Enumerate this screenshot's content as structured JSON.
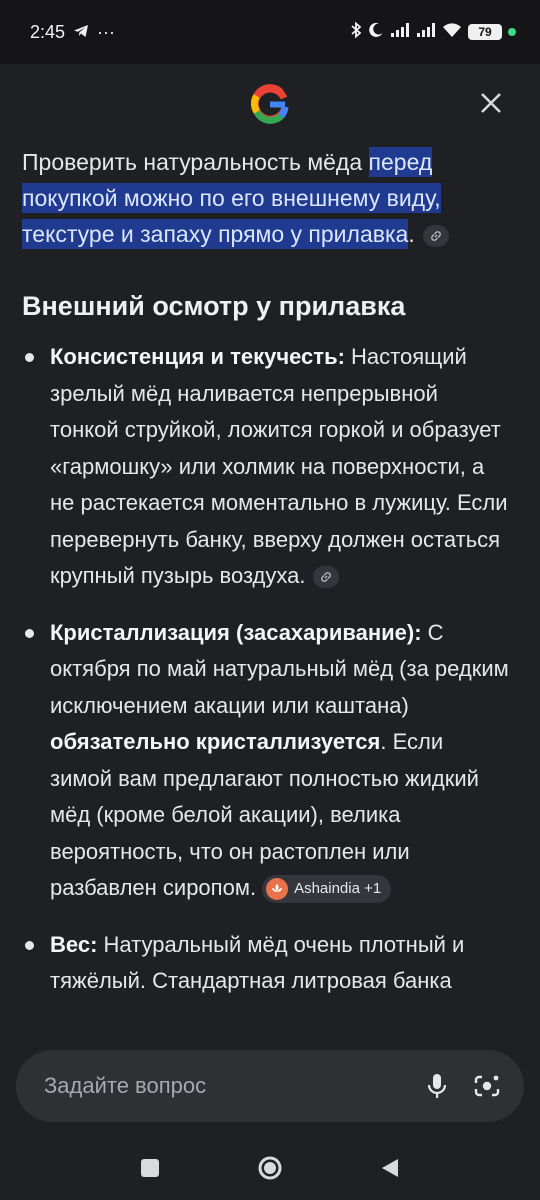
{
  "status_bar": {
    "time": "2:45",
    "dots": "···",
    "battery": "79"
  },
  "answer": {
    "intro_plain": "Проверить натуральность мёда ",
    "intro_highlight": "перед покупкой можно по его внешнему виду, текстуре и запаху прямо у прилавка",
    "intro_end": ".",
    "section_title": "Внешний осмотр у прилавка",
    "items": [
      {
        "term": "Консистенция и текучесть:",
        "text": " Настоящий зрелый мёд наливается непрерывной тонкой струйкой, ложится горкой и образует «гармошку» или холмик на поверхности, а не растекается моментально в лужицу. Если перевернуть банку, вверху должен остаться крупный пузырь воздуха."
      },
      {
        "term": "Кристаллизация (засахаривание):",
        "text_before": " С октября по май натуральный мёд (за редким исключением акации или каштана) ",
        "bold_mid": "обязательно кристаллизуется",
        "text_after": ". Если зимой вам предлагают полностью жидкий мёд (кроме белой акации), велика вероятность, что он растоплен или разбавлен сиропом.",
        "source": "Ashaindia +1"
      },
      {
        "term": "Вес:",
        "text": " Натуральный мёд очень плотный и тяжёлый. Стандартная литровая банка"
      }
    ]
  },
  "ask": {
    "placeholder": "Задайте вопрос"
  },
  "icons": {
    "logo": "google-logo",
    "close": "close-icon",
    "link": "link-icon",
    "mic": "microphone-icon",
    "lens": "lens-camera-icon"
  }
}
